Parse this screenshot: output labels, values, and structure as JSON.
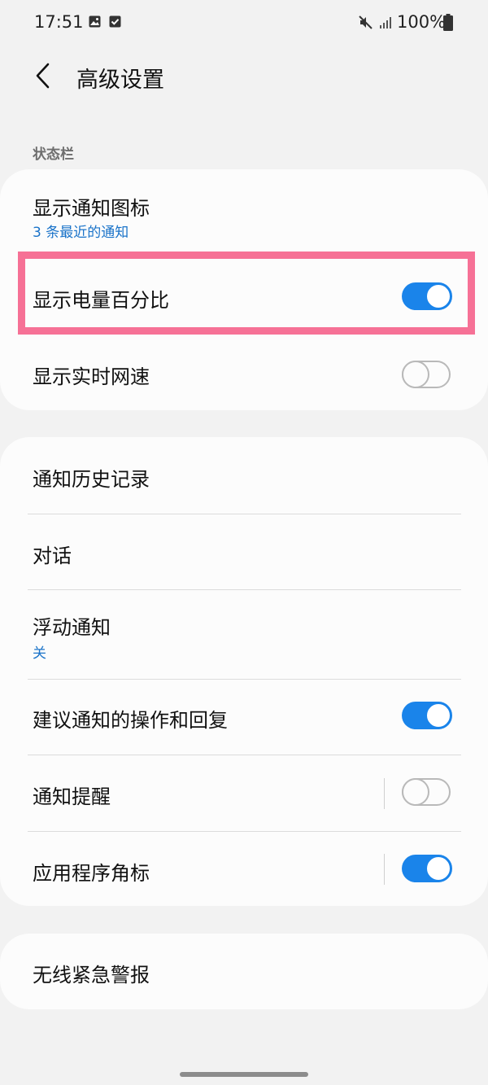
{
  "status_bar": {
    "time": "17:51",
    "battery_text": "100%",
    "icons": [
      "image-icon",
      "check-box-icon",
      "mute-icon",
      "signal-icon",
      "battery-icon"
    ]
  },
  "header": {
    "title": "高级设置",
    "back_icon": "chevron-left-icon"
  },
  "status_section": {
    "label": "状态栏",
    "items": [
      {
        "title": "显示通知图标",
        "subtitle": "3 条最近的通知"
      },
      {
        "title": "显示电量百分比",
        "toggle": "on"
      },
      {
        "title": "显示实时网速",
        "toggle": "off"
      }
    ]
  },
  "notification_section": {
    "items": [
      {
        "title": "通知历史记录"
      },
      {
        "title": "对话"
      },
      {
        "title": "浮动通知",
        "subtitle": "关"
      },
      {
        "title": "建议通知的操作和回复",
        "toggle": "on"
      },
      {
        "title": "通知提醒",
        "toggle": "off"
      },
      {
        "title": "应用程序角标",
        "toggle": "on"
      }
    ]
  },
  "emergency_section": {
    "items": [
      {
        "title": "无线紧急警报"
      }
    ]
  },
  "colors": {
    "accent": "#1a84ea",
    "subtitle": "#1a73c9",
    "highlight": "#f67196",
    "background": "#f2f2f2",
    "card": "#fcfcfc"
  }
}
